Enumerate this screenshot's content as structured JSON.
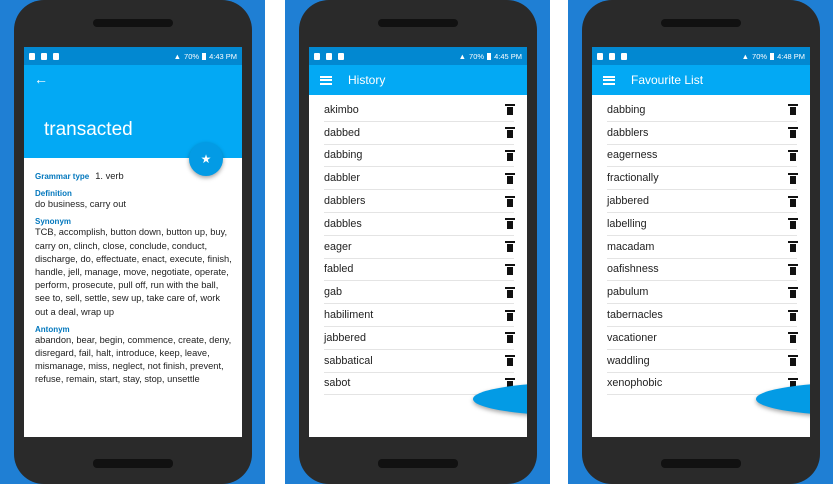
{
  "colors": {
    "frame_bg": "#1f7fd4",
    "appbar": "#03a9f4",
    "statusbar": "#0288d1",
    "label": "#0277bd"
  },
  "screens": [
    {
      "status_time": "4:43 PM",
      "status_battery": "70%",
      "word": "transacted",
      "grammar_label": "Grammar type",
      "grammar_value": "1. verb",
      "definition_label": "Definition",
      "definition": "do business, carry out",
      "synonym_label": "Synonym",
      "synonyms": "TCB, accomplish, button down, button up, buy, carry on, clinch, close, conclude, conduct, discharge, do, effectuate, enact, execute, finish, handle, jell, manage, move, negotiate, operate, perform, prosecute, pull off, run with the ball, see to, sell, settle, sew up, take care of, work out a deal, wrap up",
      "antonym_label": "Antonym",
      "antonyms": "abandon, bear, begin, commence, create, deny, disregard, fail, halt, introduce, keep, leave, mismanage, miss, neglect, not finish, prevent, refuse, remain, start, stay, stop, unsettle",
      "icons": [
        "back-arrow-icon",
        "star-icon"
      ]
    },
    {
      "status_time": "4:45 PM",
      "status_battery": "70%",
      "title": "History",
      "items": [
        "akimbo",
        "dabbed",
        "dabbing",
        "dabbler",
        "dabblers",
        "dabbles",
        "eager",
        "fabled",
        "gab",
        "habiliment",
        "jabbered",
        "sabbatical",
        "sabot"
      ],
      "icons": [
        "menu-icon",
        "trash-icon",
        "list-icon"
      ]
    },
    {
      "status_time": "4:48 PM",
      "status_battery": "70%",
      "title": "Favourite List",
      "items": [
        "dabbing",
        "dabblers",
        "eagerness",
        "fractionally",
        "jabbered",
        "labelling",
        "macadam",
        "oafishness",
        "pabulum",
        "tabernacles",
        "vacationer",
        "waddling",
        "xenophobic"
      ],
      "icons": [
        "menu-icon",
        "trash-icon",
        "list-icon"
      ]
    }
  ]
}
